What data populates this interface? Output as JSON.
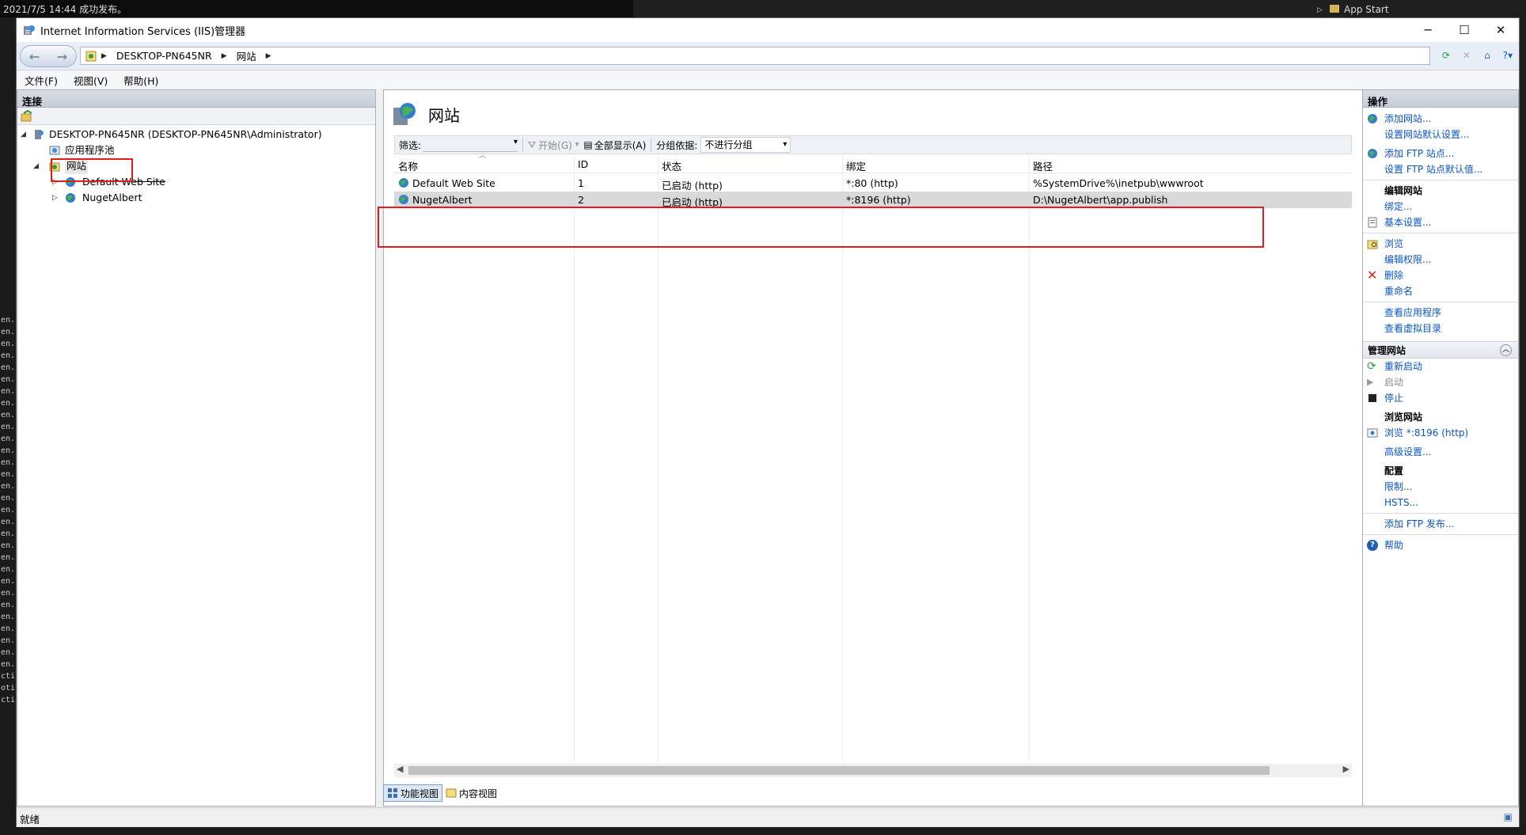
{
  "background": {
    "top_text": "2021/7/5 14:44 成功发布。",
    "right_tree_item": "App Start",
    "left_terminal_lines": [
      "en.",
      "en.",
      "en.",
      "en.",
      "en.",
      "en.",
      "en.",
      "en.",
      "en.",
      "en.",
      "en.",
      "en.",
      "en.",
      "en.",
      "en.",
      "en.",
      "en.",
      "en.",
      "en.",
      "en.",
      "en.",
      "en.",
      "en.",
      "en.",
      "en.",
      "en.",
      "en.",
      "en.",
      "en.",
      "en.",
      "cti",
      "oti",
      "cti"
    ]
  },
  "window": {
    "title": "Internet Information Services (IIS)管理器",
    "caption": {
      "minimize": "─",
      "maximize": "☐",
      "close": "✕"
    }
  },
  "address": {
    "crumbs": [
      "DESKTOP-PN645NR",
      "网站"
    ]
  },
  "menu": [
    "文件(F)",
    "视图(V)",
    "帮助(H)"
  ],
  "connections": {
    "header": "连接",
    "tree": {
      "server": "DESKTOP-PN645NR (DESKTOP-PN645NR\\Administrator)",
      "app_pools": "应用程序池",
      "sites": "网站",
      "site_items": [
        "Default Web Site",
        "NugetAlbert"
      ]
    }
  },
  "center": {
    "title": "网站",
    "filter": {
      "label": "筛选:",
      "start": "开始(G)",
      "show_all": "全部显示(A)",
      "group_label": "分组依据:",
      "group_value": "不进行分组"
    },
    "columns": [
      "名称",
      "ID",
      "状态",
      "绑定",
      "路径"
    ],
    "rows": [
      {
        "name": "Default Web Site",
        "id": "1",
        "status": "已启动 (http)",
        "binding": "*:80 (http)",
        "path": "%SystemDrive%\\inetpub\\wwwroot"
      },
      {
        "name": "NugetAlbert",
        "id": "2",
        "status": "已启动 (http)",
        "binding": "*:8196 (http)",
        "path": "D:\\NugetAlbert\\app.publish"
      }
    ],
    "view_tabs": [
      "功能视图",
      "内容视图"
    ]
  },
  "actions": {
    "header": "操作",
    "add_site": "添加网站...",
    "site_defaults": "设置网站默认设置...",
    "add_ftp_site": "添加 FTP 站点...",
    "ftp_defaults": "设置 FTP 站点默认值...",
    "edit_site_head": "编辑网站",
    "bindings": "绑定...",
    "basic_settings": "基本设置...",
    "explore": "浏览",
    "edit_permissions": "编辑权限...",
    "remove": "删除",
    "rename": "重命名",
    "view_apps": "查看应用程序",
    "view_vdirs": "查看虚拟目录",
    "manage_site_group": "管理网站",
    "restart": "重新启动",
    "start": "启动",
    "stop": "停止",
    "browse_head": "浏览网站",
    "browse_link": "浏览 *:8196 (http)",
    "advanced": "高级设置...",
    "config_head": "配置",
    "limits": "限制...",
    "hsts": "HSTS...",
    "add_ftp_publish": "添加 FTP 发布...",
    "help": "帮助"
  },
  "status": {
    "text": "就绪"
  },
  "colors": {
    "highlight": "#e21c1c",
    "link": "#0a55c4",
    "selected_row": "#d9d9d9"
  }
}
